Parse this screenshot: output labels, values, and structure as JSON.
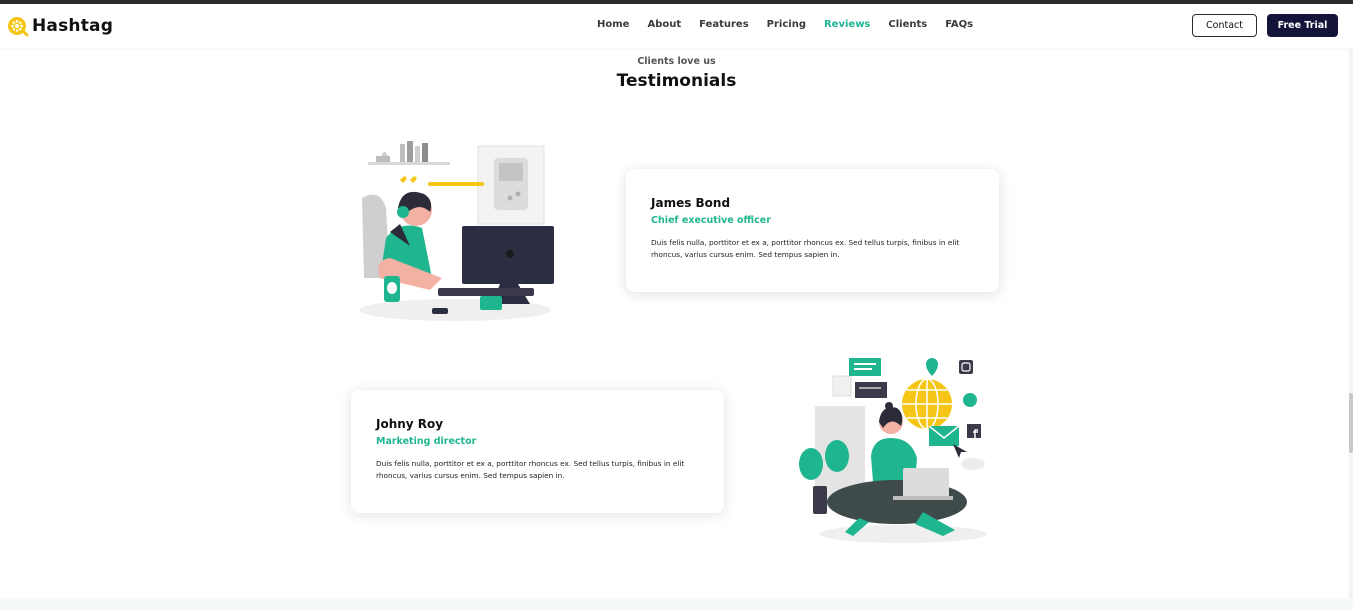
{
  "header": {
    "logo_text": "Hashtag",
    "nav": [
      {
        "label": "Home"
      },
      {
        "label": "About"
      },
      {
        "label": "Features"
      },
      {
        "label": "Pricing"
      },
      {
        "label": "Reviews",
        "active": true
      },
      {
        "label": "Clients"
      },
      {
        "label": "FAQs"
      }
    ],
    "contact_label": "Contact",
    "trial_label": "Free Trial"
  },
  "section": {
    "eyebrow": "Clients love us",
    "title": "Testimonials"
  },
  "testimonials": [
    {
      "name": "James Bond",
      "role": "Chief executive officer",
      "quote": "Duis felis nulla, porttitor et ex a, porttitor rhoncus ex. Sed tellus turpis, finibus in elit rhoncus, varius cursus enim. Sed tempus sapien in."
    },
    {
      "name": "Johny Roy",
      "role": "Marketing director",
      "quote": "Duis felis nulla, porttitor et ex a, porttitor rhoncus ex. Sed tellus turpis, finibus in elit rhoncus, varius cursus enim. Sed tempus sapien in."
    }
  ],
  "colors": {
    "accent": "#1fb58f",
    "navy": "#14143a",
    "logo_yellow": "#f5c518"
  },
  "icons": [
    "hashtag-logo-icon",
    "gamer-illustration",
    "social-media-illustration"
  ]
}
